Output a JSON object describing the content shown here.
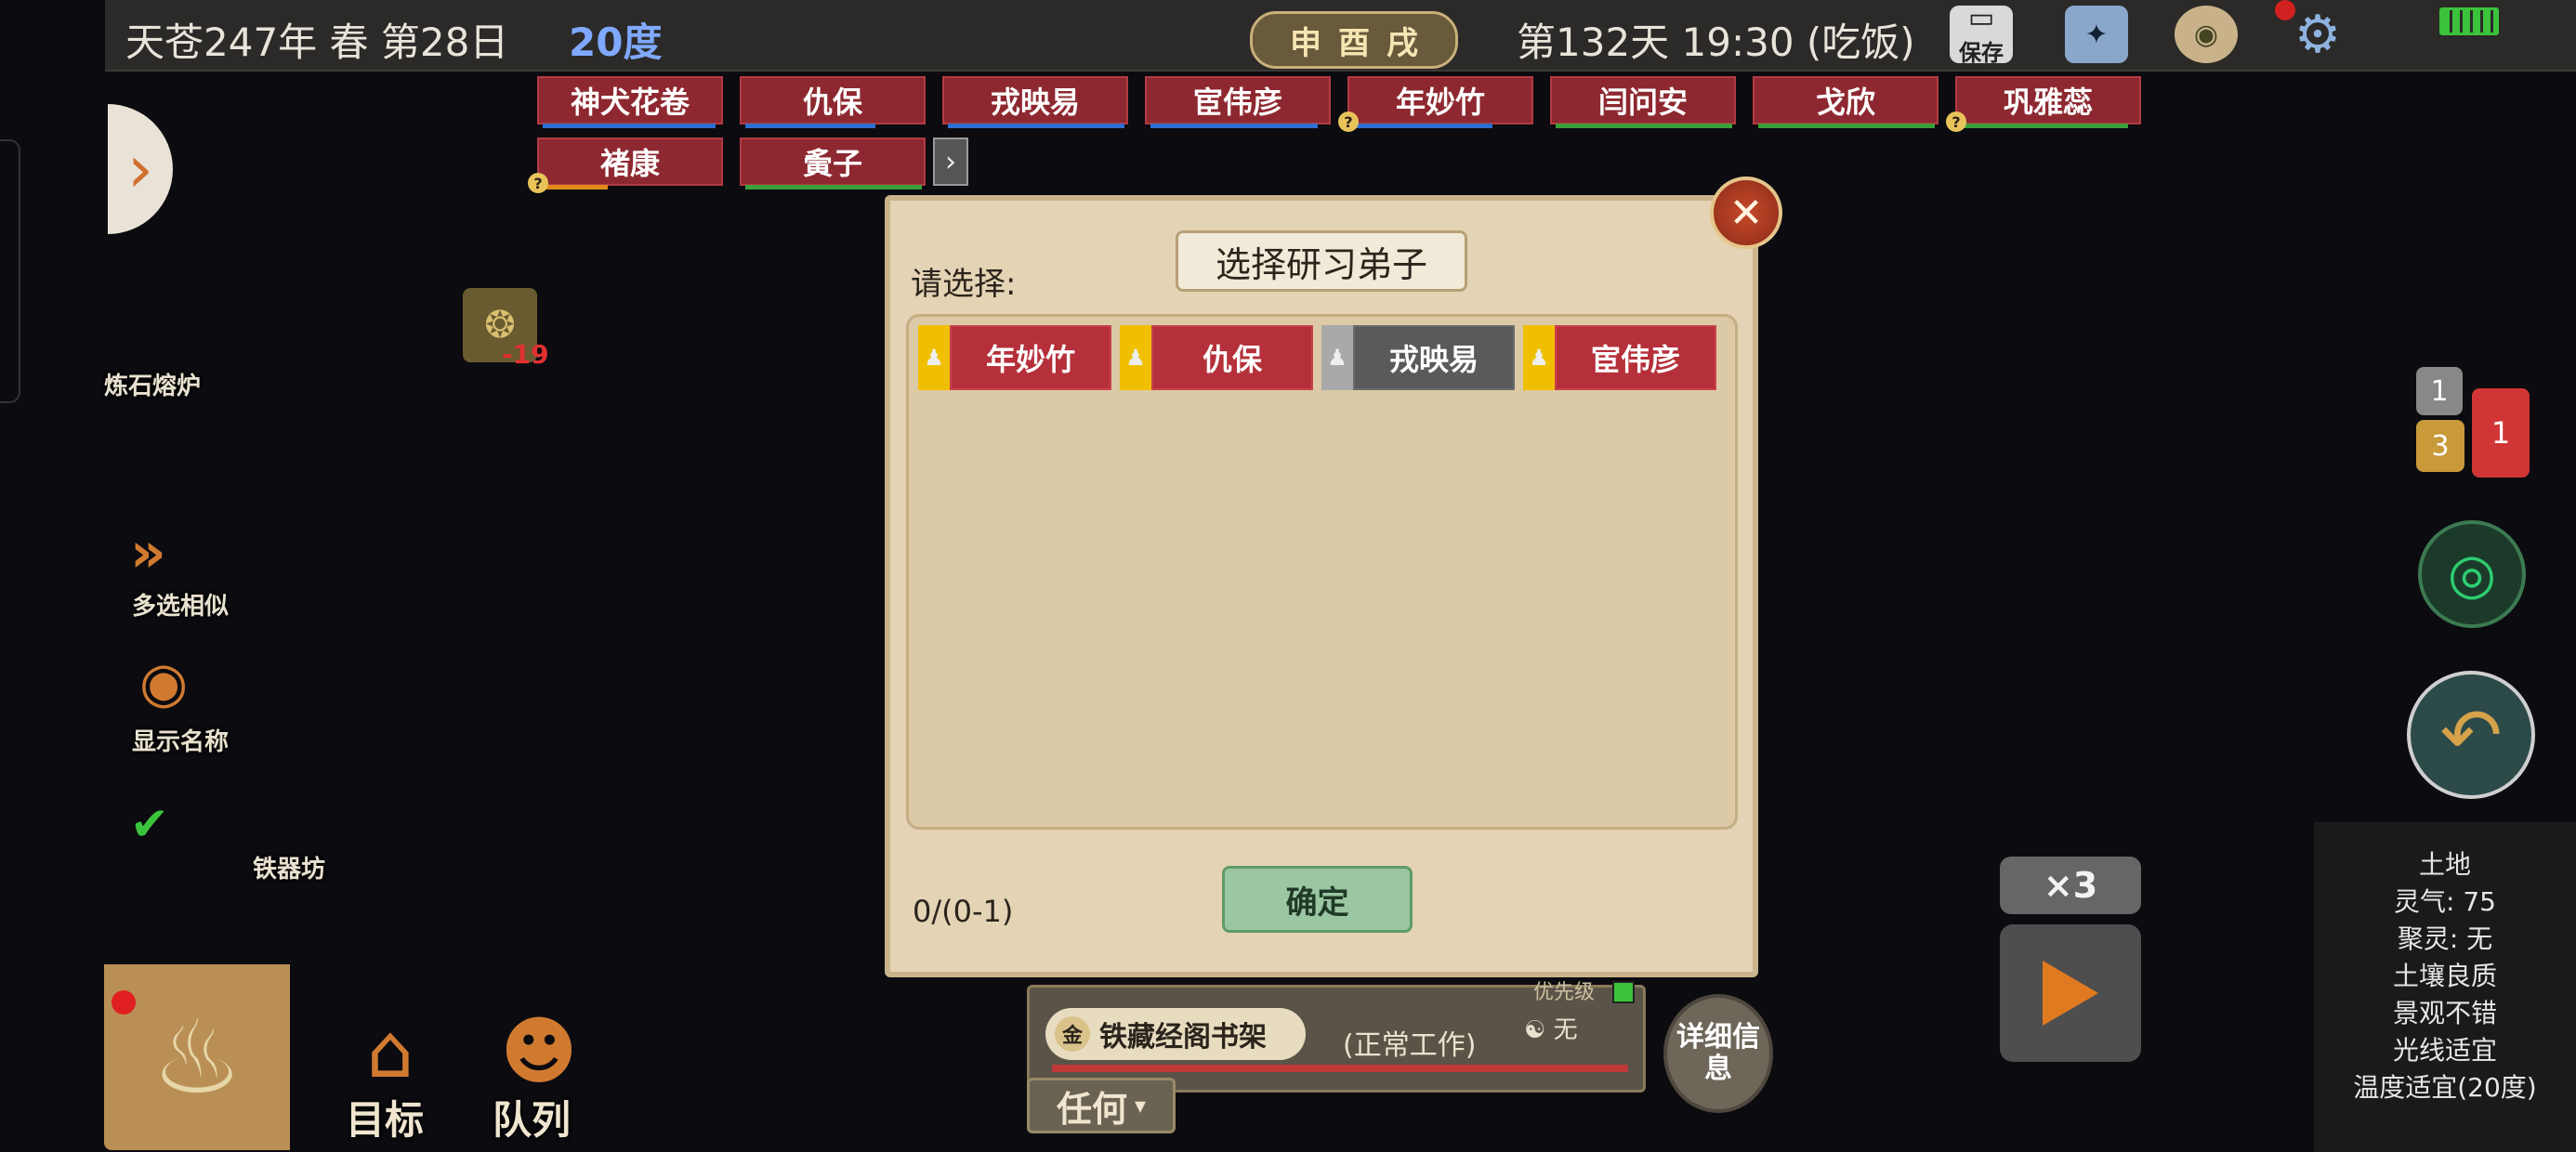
{
  "topbar": {
    "date": "天苍247年 春 第28日",
    "temperature": "20度",
    "ganzhi": [
      "申",
      "酉",
      "戌"
    ],
    "day_time": "第132天 19:30 (吃饭)",
    "save_label": "保存"
  },
  "disciple_tags": [
    {
      "name": "神犬花卷",
      "bar_color": "#2e6fd1",
      "bar": 0.9
    },
    {
      "name": "仇保",
      "bar_color": "#2e6fd1",
      "bar": 0.7
    },
    {
      "name": "戎映易",
      "bar_color": "#2e6fd1",
      "bar": 0.95
    },
    {
      "name": "宦伟彦",
      "bar_color": "#2e6fd1",
      "bar": 0.9
    },
    {
      "name": "年妙竹",
      "bar_color": "#2e6fd1",
      "bar": 0.75
    },
    {
      "name": "闫问安",
      "bar_color": "#39a039",
      "bar": 0.95
    },
    {
      "name": "戈欣",
      "bar_color": "#39a039",
      "bar": 0.95
    },
    {
      "name": "巩雅蕊",
      "bar_color": "#39a039",
      "bar": 0.9
    },
    {
      "name": "褚康",
      "bar_color": "#e08a1a",
      "bar": 0.35
    },
    {
      "name": "夤子",
      "bar_color": "#39a039",
      "bar": 0.95
    }
  ],
  "left_panel": {
    "furnace_label": "炼石熔炉",
    "resource_count": "-19",
    "multi_select": "多选相似",
    "show_names": "显示名称",
    "workshop_label": "铁器坊",
    "goal": "目标",
    "queue": "队列"
  },
  "dialog": {
    "title": "选择研习弟子",
    "prompt": "请选择:",
    "options": [
      {
        "name": "年妙竹",
        "style": "red"
      },
      {
        "name": "仇保",
        "style": "red"
      },
      {
        "name": "戎映易",
        "style": "gray"
      },
      {
        "name": "宦伟彦",
        "style": "red"
      }
    ],
    "count": "0/(0-1)",
    "confirm": "确定",
    "close": "✕"
  },
  "work_panel": {
    "building": "铁藏经阁书架",
    "state": "(正常工作)",
    "priority": "优先级",
    "wu": "无",
    "any": "任何",
    "detail": "详细信息"
  },
  "notifications": {
    "gray": "1",
    "yellow": "3",
    "red": "1"
  },
  "speed": "×3",
  "land_info": [
    "土地",
    "灵气: 75",
    "聚灵: 无",
    "土壤良质",
    "景观不错",
    "光线适宜",
    "温度适宜(20度)"
  ]
}
